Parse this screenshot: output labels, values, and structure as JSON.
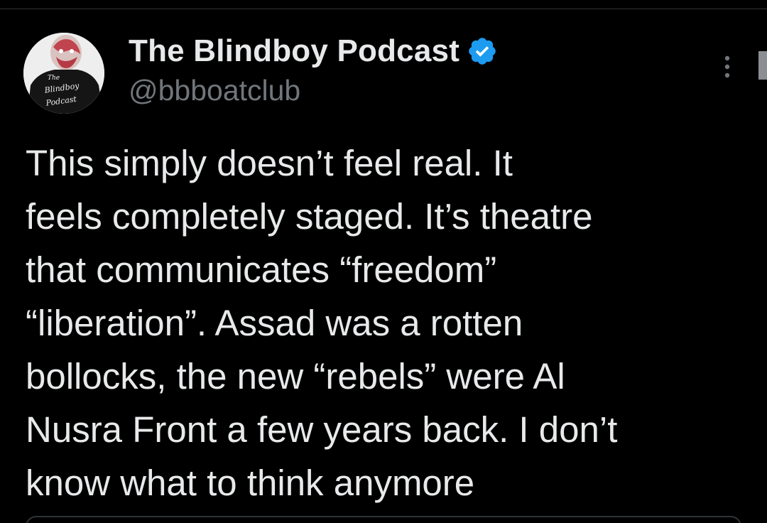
{
  "colors": {
    "background": "#000000",
    "primary_text": "#e7e9ea",
    "secondary_text": "#71767b",
    "verified_badge": "#1d9bf0"
  },
  "author": {
    "display_name": "The Blindboy Podcast",
    "handle": "@bbboatclub",
    "verified_icon": "verified-badge-icon",
    "avatar_text_line1": "The",
    "avatar_text_line2": "Blindboy",
    "avatar_text_line3": "Podcast"
  },
  "menu": {
    "icon": "more-options-icon"
  },
  "tweet": {
    "lines": [
      "This simply doesn’t feel real. It",
      "feels completely staged. It’s theatre",
      "that communicates “freedom”",
      "“liberation”. Assad was a rotten",
      "bollocks, the new “rebels” were Al",
      "Nusra Front a few years back. I don’t",
      "know what to think anymore"
    ]
  }
}
